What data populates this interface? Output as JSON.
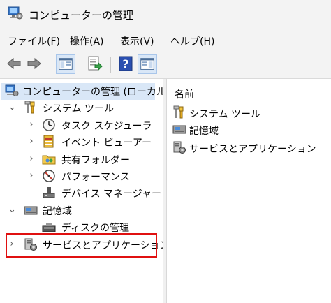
{
  "window": {
    "title": "コンピューターの管理"
  },
  "menu": [
    "ファイル(F)",
    "操作(A)",
    "表示(V)",
    "ヘルプ(H)"
  ],
  "toolbar": {
    "buttons": [
      "back-arrow-icon",
      "forward-arrow-icon",
      "show-hide-console-tree-icon",
      "export-list-icon",
      "help-icon",
      "show-action-pane-icon"
    ]
  },
  "tree": {
    "root": "コンピューターの管理 (ローカル)",
    "system_tools": "システム ツール",
    "task_scheduler": "タスク スケジューラ",
    "event_viewer": "イベント ビューアー",
    "shared_folders": "共有フォルダー",
    "performance": "パフォーマンス",
    "device_manager": "デバイス マネージャー",
    "storage": "記憶域",
    "disk_management": "ディスクの管理",
    "services_apps": "サービスとアプリケーション"
  },
  "list": {
    "column_header": "名前",
    "items": [
      "システム ツール",
      "記憶域",
      "サービスとアプリケーション"
    ]
  },
  "colors": {
    "selection": "#d9e7f7",
    "highlight_border": "#e01010"
  }
}
